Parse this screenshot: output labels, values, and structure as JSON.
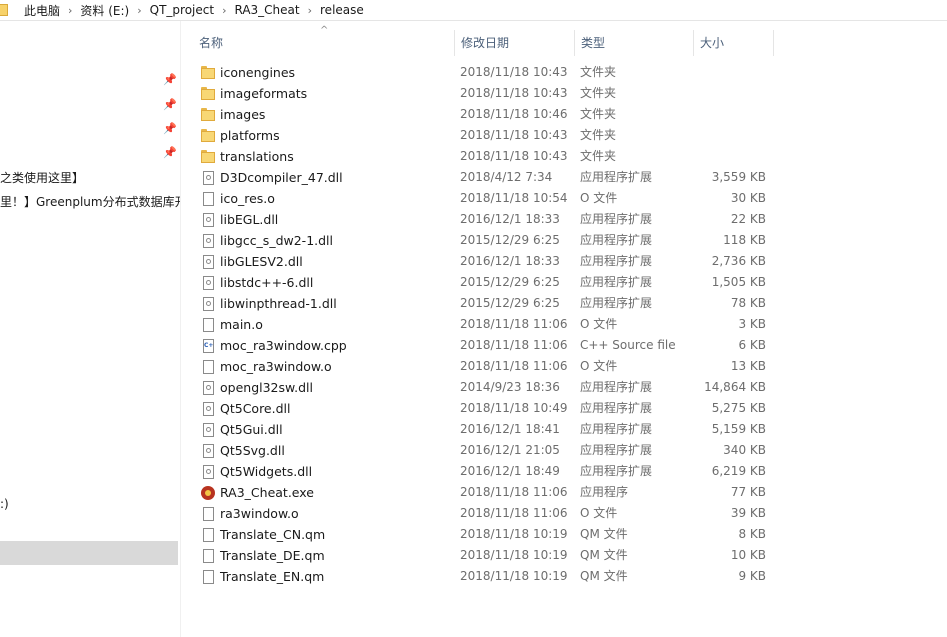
{
  "breadcrumb": [
    "此电脑",
    "资料 (E:)",
    "QT_project",
    "RA3_Cheat",
    "release"
  ],
  "breadcrumb_separator": "›",
  "nav": {
    "pin_glyph": "📌",
    "fragments": [
      "之类使用这里】",
      "里！】Greenplum分布式数据库开",
      ":)"
    ]
  },
  "columns": {
    "name": "名称",
    "date": "修改日期",
    "type": "类型",
    "size": "大小"
  },
  "sort_indicator": "^",
  "files": [
    {
      "name": "iconengines",
      "date": "2018/11/18 10:43",
      "type": "文件夹",
      "size": "",
      "icon": "folder-icon"
    },
    {
      "name": "imageformats",
      "date": "2018/11/18 10:43",
      "type": "文件夹",
      "size": "",
      "icon": "folder-icon"
    },
    {
      "name": "images",
      "date": "2018/11/18 10:46",
      "type": "文件夹",
      "size": "",
      "icon": "folder-icon"
    },
    {
      "name": "platforms",
      "date": "2018/11/18 10:43",
      "type": "文件夹",
      "size": "",
      "icon": "folder-icon"
    },
    {
      "name": "translations",
      "date": "2018/11/18 10:43",
      "type": "文件夹",
      "size": "",
      "icon": "folder-icon"
    },
    {
      "name": "D3Dcompiler_47.dll",
      "date": "2018/4/12 7:34",
      "type": "应用程序扩展",
      "size": "3,559 KB",
      "icon": "dll-file-icon"
    },
    {
      "name": "ico_res.o",
      "date": "2018/11/18 10:54",
      "type": "O 文件",
      "size": "30 KB",
      "icon": "file-icon"
    },
    {
      "name": "libEGL.dll",
      "date": "2016/12/1 18:33",
      "type": "应用程序扩展",
      "size": "22 KB",
      "icon": "dll-file-icon"
    },
    {
      "name": "libgcc_s_dw2-1.dll",
      "date": "2015/12/29 6:25",
      "type": "应用程序扩展",
      "size": "118 KB",
      "icon": "dll-file-icon"
    },
    {
      "name": "libGLESV2.dll",
      "date": "2016/12/1 18:33",
      "type": "应用程序扩展",
      "size": "2,736 KB",
      "icon": "dll-file-icon"
    },
    {
      "name": "libstdc++-6.dll",
      "date": "2015/12/29 6:25",
      "type": "应用程序扩展",
      "size": "1,505 KB",
      "icon": "dll-file-icon"
    },
    {
      "name": "libwinpthread-1.dll",
      "date": "2015/12/29 6:25",
      "type": "应用程序扩展",
      "size": "78 KB",
      "icon": "dll-file-icon"
    },
    {
      "name": "main.o",
      "date": "2018/11/18 11:06",
      "type": "O 文件",
      "size": "3 KB",
      "icon": "file-icon"
    },
    {
      "name": "moc_ra3window.cpp",
      "date": "2018/11/18 11:06",
      "type": "C++ Source file",
      "size": "6 KB",
      "icon": "cpp-file-icon"
    },
    {
      "name": "moc_ra3window.o",
      "date": "2018/11/18 11:06",
      "type": "O 文件",
      "size": "13 KB",
      "icon": "file-icon"
    },
    {
      "name": "opengl32sw.dll",
      "date": "2014/9/23 18:36",
      "type": "应用程序扩展",
      "size": "14,864 KB",
      "icon": "dll-file-icon"
    },
    {
      "name": "Qt5Core.dll",
      "date": "2018/11/18 10:49",
      "type": "应用程序扩展",
      "size": "5,275 KB",
      "icon": "dll-file-icon"
    },
    {
      "name": "Qt5Gui.dll",
      "date": "2016/12/1 18:41",
      "type": "应用程序扩展",
      "size": "5,159 KB",
      "icon": "dll-file-icon"
    },
    {
      "name": "Qt5Svg.dll",
      "date": "2016/12/1 21:05",
      "type": "应用程序扩展",
      "size": "340 KB",
      "icon": "dll-file-icon"
    },
    {
      "name": "Qt5Widgets.dll",
      "date": "2016/12/1 18:49",
      "type": "应用程序扩展",
      "size": "6,219 KB",
      "icon": "dll-file-icon"
    },
    {
      "name": "RA3_Cheat.exe",
      "date": "2018/11/18 11:06",
      "type": "应用程序",
      "size": "77 KB",
      "icon": "exe-app-icon"
    },
    {
      "name": "ra3window.o",
      "date": "2018/11/18 11:06",
      "type": "O 文件",
      "size": "39 KB",
      "icon": "file-icon"
    },
    {
      "name": "Translate_CN.qm",
      "date": "2018/11/18 10:19",
      "type": "QM 文件",
      "size": "8 KB",
      "icon": "file-icon"
    },
    {
      "name": "Translate_DE.qm",
      "date": "2018/11/18 10:19",
      "type": "QM 文件",
      "size": "10 KB",
      "icon": "file-icon"
    },
    {
      "name": "Translate_EN.qm",
      "date": "2018/11/18 10:19",
      "type": "QM 文件",
      "size": "9 KB",
      "icon": "file-icon"
    }
  ]
}
